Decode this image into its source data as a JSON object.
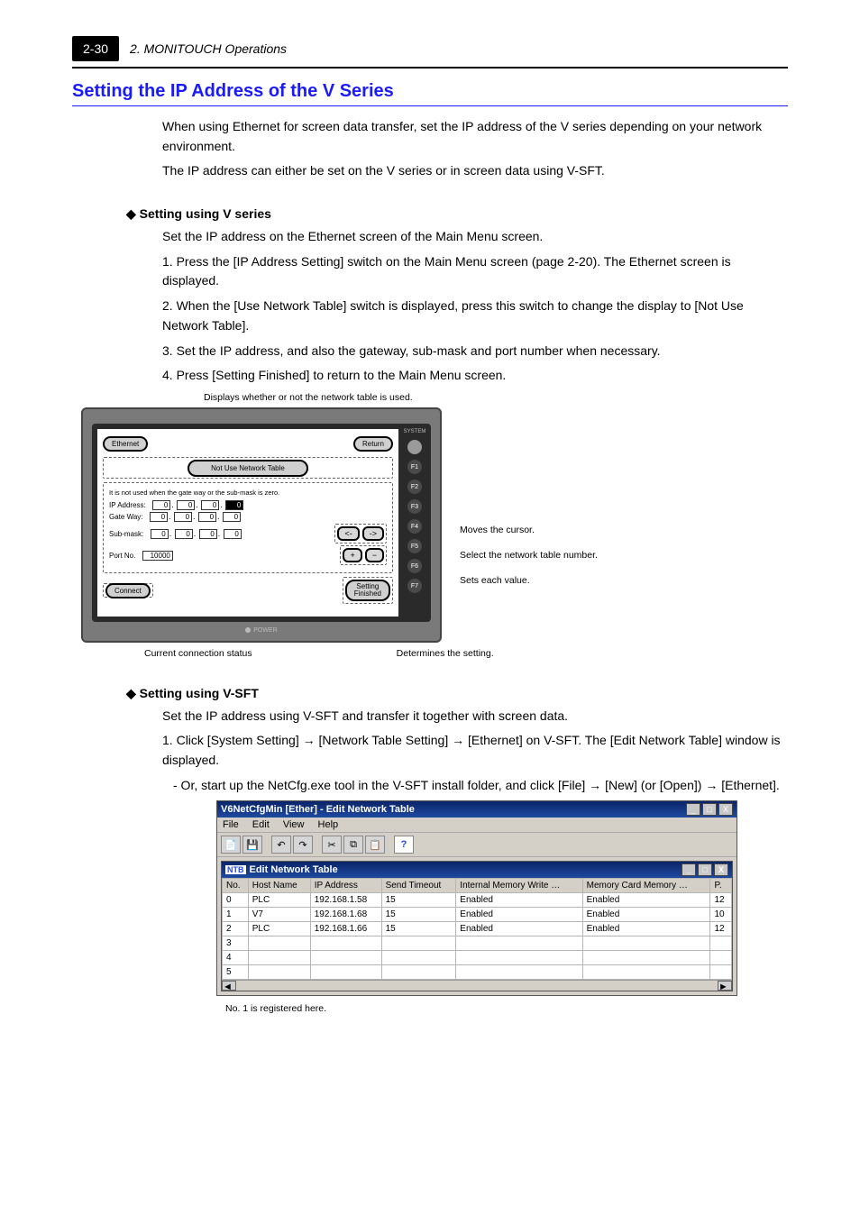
{
  "header": {
    "page_box": "2-30",
    "chapter": "2. MONITOUCH Operations"
  },
  "section_title": "Setting the IP Address of the V Series",
  "para": {
    "intro1": "When using Ethernet for screen data transfer, set the IP address of the V series depending on your network environment.",
    "intro2": "The IP address can either be set on the V series or in screen data using V-SFT.",
    "m1_h": "Setting using V series",
    "m1_1": "Set the IP address on the Ethernet screen of the Main Menu screen.",
    "m1_step1": "Press the [IP Address Setting] switch on the Main Menu screen (page 2-20). The Ethernet screen is displayed.",
    "m1_step2": "When the [Use Network Table] switch is displayed, press this switch to change the display to [Not Use Network Table].",
    "m1_step3": "Set the IP address, and also the gateway, sub-mask and port number when necessary.",
    "m1_step4": "Press [Setting Finished] to return to the Main Menu screen.",
    "m2_h": "Setting using V-SFT",
    "m2_line": "Set the IP address using V-SFT and transfer it together with screen data.",
    "m2_s1a": "Click [System Setting] ",
    "m2_s1b": " [Network Table Setting] ",
    "m2_s1c": " [Ethernet] on V-SFT. The [Edit Network Table] window is displayed.",
    "m2_s1a2": "- Or, start up the NetCfg.exe tool in the V-SFT install folder, and click [File] ",
    "m2_s1b2": " [New] (or [Open]) ",
    "m2_s1c2": " [Ethernet]."
  },
  "callouts": {
    "top1": "Displays whether or not the network table is used.",
    "top2": "Moves the cursor.",
    "side1": "Select the network table number.",
    "side2": "Sets each value.",
    "bot1": "Current connection status",
    "bot2": "Determines the setting."
  },
  "device": {
    "title": "Ethernet",
    "return_btn": "Return",
    "not_use": "Not Use Network Table",
    "gw_note": "It is not used when the gate way or the sub-mask is zero.",
    "ip_label": "IP Address:",
    "gw_label": "Gate Way:",
    "sm_label": "Sub-mask:",
    "port_label": "Port No.",
    "ip_oct": [
      "0",
      "0",
      "0",
      "0"
    ],
    "gw_oct": [
      "0",
      "0",
      "0",
      "0"
    ],
    "sm_oct": [
      "0",
      "0",
      "0",
      "0"
    ],
    "port": "10000",
    "left_btn": "<-",
    "right_btn": "->",
    "plus": "+",
    "minus": "−",
    "connect": "Connect",
    "setfin1": "Setting",
    "setfin2": "Finished",
    "power": "POWER",
    "fn": [
      "SYSTEM",
      "F1",
      "F2",
      "F3",
      "F4",
      "F5",
      "F6",
      "F7"
    ]
  },
  "app": {
    "title": "V6NetCfgMin [Ether]  - Edit Network Table",
    "menus": [
      "File",
      "Edit",
      "View",
      "Help"
    ],
    "inner_title": "Edit Network Table",
    "columns": [
      "No.",
      "Host Name",
      "IP Address",
      "Send Timeout",
      "Internal Memory Write …",
      "Memory Card Memory …",
      "P."
    ],
    "rows": [
      {
        "no": "0",
        "host": "PLC",
        "ip": "192.168.1.58",
        "to": "15",
        "im": "Enabled",
        "mc": "Enabled",
        "p": "12"
      },
      {
        "no": "1",
        "host": "V7",
        "ip": "192.168.1.68",
        "to": "15",
        "im": "Enabled",
        "mc": "Enabled",
        "p": "10"
      },
      {
        "no": "2",
        "host": "PLC",
        "ip": "192.168.1.66",
        "to": "15",
        "im": "Enabled",
        "mc": "Enabled",
        "p": "12"
      },
      {
        "no": "3",
        "host": "",
        "ip": "",
        "to": "",
        "im": "",
        "mc": "",
        "p": ""
      },
      {
        "no": "4",
        "host": "",
        "ip": "",
        "to": "",
        "im": "",
        "mc": "",
        "p": ""
      },
      {
        "no": "5",
        "host": "",
        "ip": "",
        "to": "",
        "im": "",
        "mc": "",
        "p": ""
      }
    ],
    "row_callout": "No. 1 is registered here.",
    "close_btn": "X"
  },
  "chart_data": {
    "type": "table",
    "title": "Edit Network Table",
    "columns": [
      "No.",
      "Host Name",
      "IP Address",
      "Send Timeout",
      "Internal Memory Write",
      "Memory Card Memory",
      "P."
    ],
    "rows": [
      [
        "0",
        "PLC",
        "192.168.1.58",
        "15",
        "Enabled",
        "Enabled",
        "12"
      ],
      [
        "1",
        "V7",
        "192.168.1.68",
        "15",
        "Enabled",
        "Enabled",
        "10"
      ],
      [
        "2",
        "PLC",
        "192.168.1.66",
        "15",
        "Enabled",
        "Enabled",
        "12"
      ]
    ]
  }
}
